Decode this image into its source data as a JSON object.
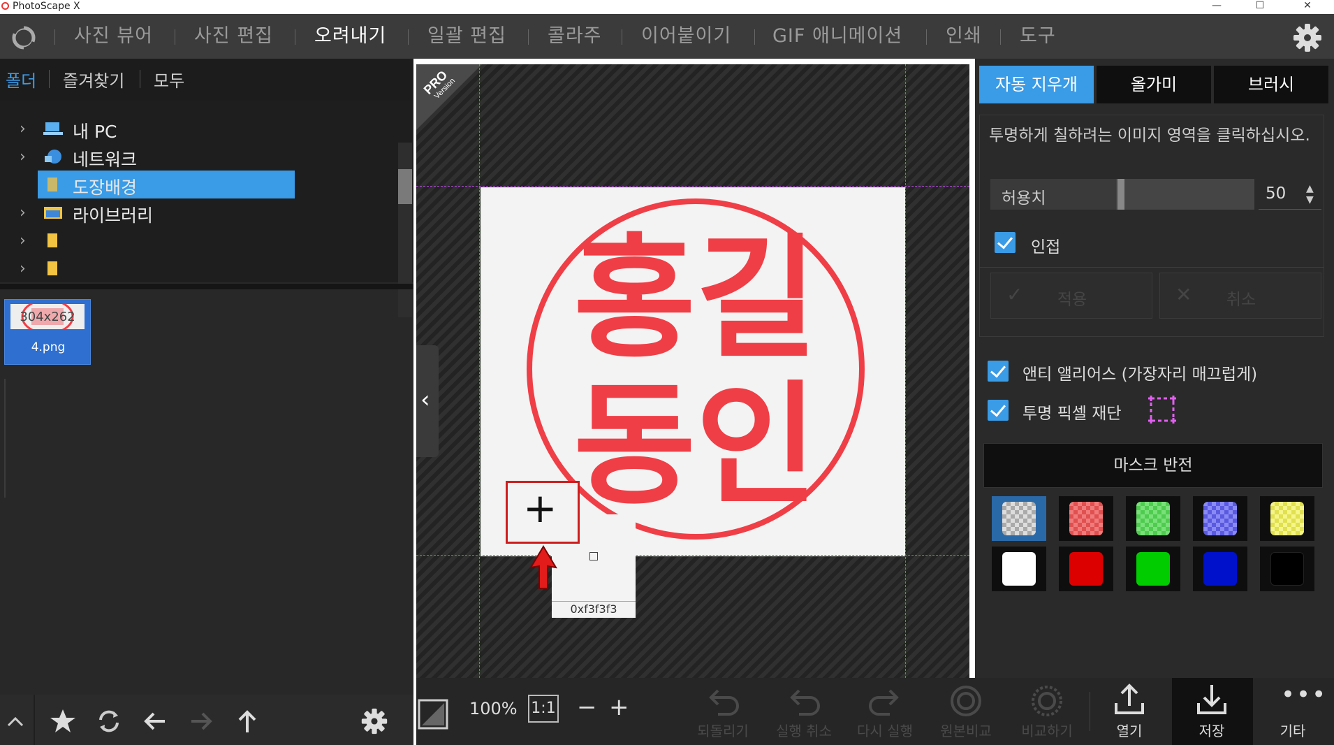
{
  "window": {
    "title": "PhotoScape X",
    "minimize": "—",
    "maximize": "☐",
    "close": "✕"
  },
  "menu": {
    "items": [
      {
        "label": "사진 뷰어",
        "active": false
      },
      {
        "label": "사진 편집",
        "active": false
      },
      {
        "label": "오려내기",
        "active": true
      },
      {
        "label": "일괄 편집",
        "active": false
      },
      {
        "label": "콜라주",
        "active": false
      },
      {
        "label": "이어붙이기",
        "active": false
      },
      {
        "label": "GIF 애니메이션",
        "active": false
      },
      {
        "label": "인쇄",
        "active": false
      },
      {
        "label": "도구",
        "active": false
      }
    ]
  },
  "left": {
    "tabs": [
      "폴더",
      "즐겨찾기",
      "모두"
    ],
    "tree": [
      {
        "label": "내 PC",
        "icon": "pc-icon"
      },
      {
        "label": "네트워크",
        "icon": "network-icon"
      },
      {
        "label": "도장배경",
        "icon": "folder-icon",
        "selected": true
      },
      {
        "label": "라이브러리",
        "icon": "library-icon"
      },
      {
        "label": "",
        "icon": "folder-icon"
      },
      {
        "label": "",
        "icon": "folder-icon"
      }
    ],
    "thumbnail": {
      "dims": "304x262",
      "filename": "4.png"
    }
  },
  "canvas": {
    "badge_top": "PRO",
    "badge_bottom": "Version",
    "stamp_line1": "홍길",
    "stamp_line2": "동인",
    "color_readout": "0xf3f3f3",
    "stamp_color": "#f03e46"
  },
  "bottom": {
    "zoom": "100%",
    "one_to_one": "1:1",
    "zoom_out": "−",
    "zoom_in": "+",
    "actions": [
      {
        "label": "되돌리기",
        "enabled": false
      },
      {
        "label": "실행 취소",
        "enabled": false
      },
      {
        "label": "다시 실행",
        "enabled": false
      },
      {
        "label": "원본비교",
        "enabled": false
      },
      {
        "label": "비교하기",
        "enabled": false
      },
      {
        "label": "열기",
        "enabled": true
      },
      {
        "label": "저장",
        "enabled": true
      },
      {
        "label": "기타",
        "enabled": true
      }
    ]
  },
  "right": {
    "tabs": [
      "자동 지우개",
      "올가미",
      "브러시"
    ],
    "hint": "투명하게 칠하려는 이미지 영역을 클릭하십시오.",
    "tolerance_label": "허용치",
    "tolerance_value": "50",
    "tolerance_fraction": 0.5,
    "adjacent_label": "인접",
    "apply_label": "적용",
    "cancel_label": "취소",
    "antialias_label": "앤티 앨리어스 (가장자리 매끄럽게)",
    "trim_label": "투명 픽셀 재단",
    "invert_mask_label": "마스크 반전",
    "swatches": [
      {
        "name": "transparent",
        "color": "checker"
      },
      {
        "name": "red-check",
        "color": "#f06a6a"
      },
      {
        "name": "green-check",
        "color": "#5fd85f"
      },
      {
        "name": "blue-check",
        "color": "#6a6af0"
      },
      {
        "name": "yellow-check",
        "color": "#f0f06a"
      },
      {
        "name": "white",
        "color": "#ffffff"
      },
      {
        "name": "red",
        "color": "#dd0000"
      },
      {
        "name": "green",
        "color": "#00cc00"
      },
      {
        "name": "blue",
        "color": "#0011cc"
      },
      {
        "name": "black",
        "color": "#000000"
      }
    ],
    "accent": "#3a9be6"
  }
}
